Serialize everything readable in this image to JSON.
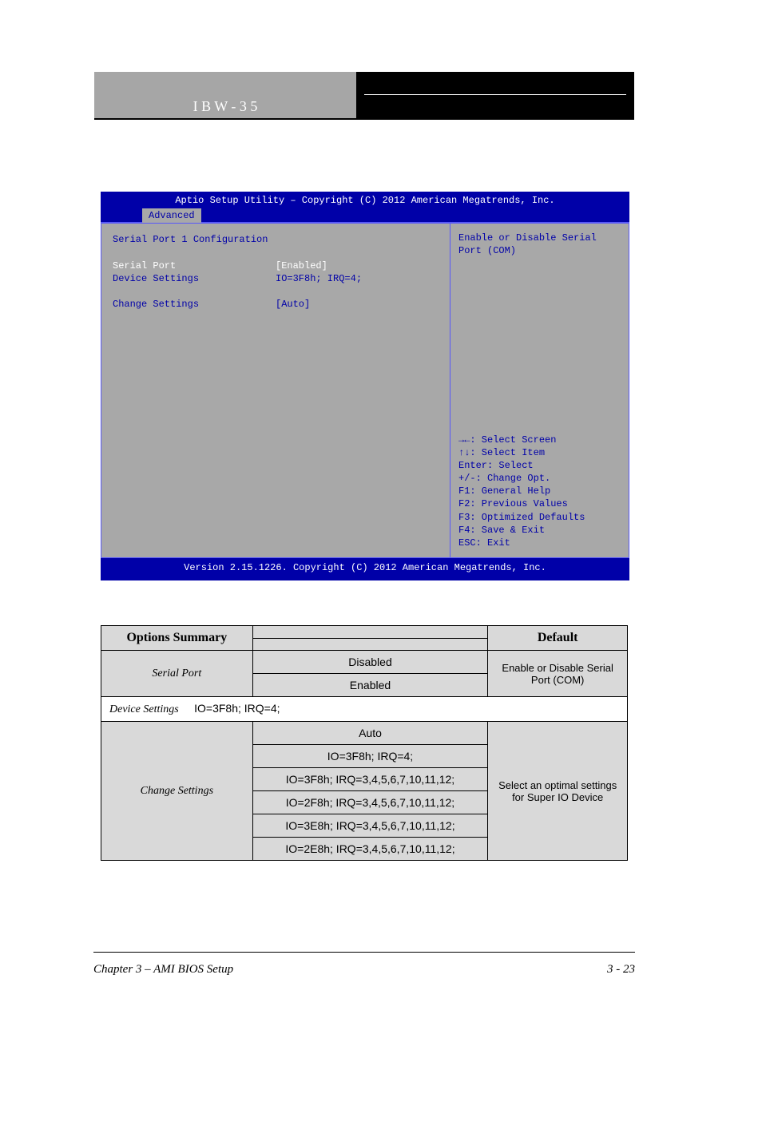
{
  "header": {
    "model": "I B W - 3 5",
    "subtitle": ""
  },
  "bios": {
    "title": "Aptio Setup Utility – Copyright (C) 2012 American Megatrends, Inc.",
    "tab": "Advanced",
    "section_title": "Serial Port 1 Configuration",
    "rows": {
      "serial_port": {
        "label": "Serial Port",
        "value": "[Enabled]"
      },
      "device_settings": {
        "label": "Device Settings",
        "value": "IO=3F8h; IRQ=4;"
      },
      "change_settings": {
        "label": "Change Settings",
        "value": "[Auto]"
      }
    },
    "help_text": "Enable or Disable Serial Port (COM)",
    "keys": [
      "→←: Select Screen",
      "↑↓: Select Item",
      "Enter: Select",
      "+/-: Change Opt.",
      "F1: General Help",
      "F2: Previous Values",
      "F3: Optimized Defaults",
      "F4: Save & Exit",
      "ESC: Exit"
    ],
    "footer": "Version 2.15.1226. Copyright (C) 2012 American Megatrends, Inc."
  },
  "table": {
    "headers": {
      "c1": "Options Summary",
      "c3": "Default"
    },
    "serial_port": {
      "label": "Serial Port",
      "opts": [
        "Disabled",
        "Enabled"
      ],
      "desc": "Enable or Disable Serial Port (COM)"
    },
    "device_settings": {
      "label": "Device Settings",
      "value": "IO=3F8h; IRQ=4;"
    },
    "change_settings": {
      "label": "Change Settings",
      "opts": [
        "Auto",
        "IO=3F8h; IRQ=4;",
        "IO=3F8h; IRQ=3,4,5,6,7,10,11,12;",
        "IO=2F8h; IRQ=3,4,5,6,7,10,11,12;",
        "IO=3E8h; IRQ=3,4,5,6,7,10,11,12;",
        "IO=2E8h; IRQ=3,4,5,6,7,10,11,12;"
      ],
      "desc": "Select an optimal settings for Super IO Device"
    }
  },
  "footer": {
    "chapter": "Chapter 3 – AMI BIOS Setup",
    "page": "3 - 23"
  }
}
